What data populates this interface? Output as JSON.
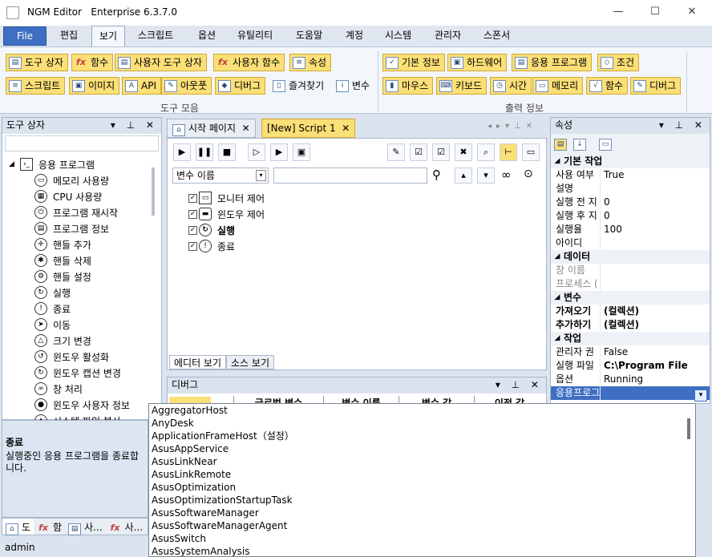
{
  "window": {
    "title": "NGM Editor",
    "edition": "Enterprise 6.3.7.0",
    "min": "—",
    "max": "☐",
    "close": "✕"
  },
  "menu": {
    "file": "File",
    "items": [
      "편집",
      "보기",
      "스크립트",
      "옵션",
      "유틸리티",
      "도움말",
      "계정",
      "시스템",
      "관리자",
      "스폰서"
    ]
  },
  "ribbon": {
    "toolbox_group": "도구 모음",
    "output_group": "출력 정보",
    "row1": [
      "도구 상자",
      "함수",
      "사용자 도구 상자",
      "사용자 함수",
      "속성"
    ],
    "row2": [
      "스크립트",
      "이미지",
      "API",
      "아웃풋",
      "디버그",
      "즐겨찾기",
      "변수"
    ],
    "row3": [
      "기본 정보",
      "하드웨어",
      "응용 프로그램",
      "조건"
    ],
    "row4": [
      "마우스",
      "키보드",
      "시간",
      "메모리",
      "함수",
      "디버그"
    ]
  },
  "toolbox": {
    "title": "도구 상자",
    "ctl": "▾ ⊥ ✕",
    "root": "응용 프로그램",
    "items": [
      "메모리 사용량",
      "CPU 사용량",
      "프로그램 재시작",
      "프로그램 정보",
      "핸들 추가",
      "핸들 삭제",
      "핸들 설정",
      "실행",
      "종료",
      "이동",
      "크기 변경",
      "윈도우 활성화",
      "윈도우 캡션 변경",
      "창 처리",
      "윈도우 사용자 정보",
      "시스템 파일 복사"
    ],
    "desc_title": "종료",
    "desc": "실행중인 응용 프로그램을 종료합니다.",
    "bottom_tabs": [
      "도",
      "함",
      "사...",
      "사..."
    ]
  },
  "status": "admin",
  "editor": {
    "tab1": "시작 페이지",
    "tab2": "[New] Script 1",
    "var_select": "변수 이름",
    "search_value": "",
    "steps": [
      "모니터 제어",
      "윈도우 제어",
      "실행",
      "종료"
    ],
    "view_tabs": [
      "에디터 보기",
      "소스 보기"
    ]
  },
  "debug": {
    "title": "디버그",
    "cols": [
      "글로벌 변수",
      "변수 이름",
      "변수 값",
      "이전 값"
    ]
  },
  "props": {
    "title": "속성",
    "cat1": "기본 작업",
    "rows1": [
      [
        "사용 여부",
        "True"
      ],
      [
        "설명",
        ""
      ],
      [
        "실행 전 지",
        "0"
      ],
      [
        "실행 후 지",
        "0"
      ],
      [
        "실행율",
        "100"
      ],
      [
        "아이디",
        ""
      ]
    ],
    "cat2": "데이터",
    "rows2": [
      [
        "창 이름",
        ""
      ],
      [
        "프로세스 (",
        ""
      ]
    ],
    "cat3": "변수",
    "rows3": [
      [
        "가져오기",
        "(컬렉션)"
      ],
      [
        "추가하기",
        "(컬렉션)"
      ]
    ],
    "cat4": "작업",
    "rows4": [
      [
        "관리자 권",
        "False"
      ],
      [
        "실행 파일",
        "C:\\Program File"
      ],
      [
        "옵션",
        "Running"
      ],
      [
        "응용프로그",
        ""
      ]
    ]
  },
  "dropdown": [
    "AggregatorHost",
    "AnyDesk",
    "ApplicationFrameHost（설정）",
    "AsusAppService",
    "AsusLinkNear",
    "AsusLinkRemote",
    "AsusOptimization",
    "AsusOptimizationStartupTask",
    "AsusSoftwareManager",
    "AsusSoftwareManagerAgent",
    "AsusSwitch",
    "AsusSystemAnalysis"
  ]
}
